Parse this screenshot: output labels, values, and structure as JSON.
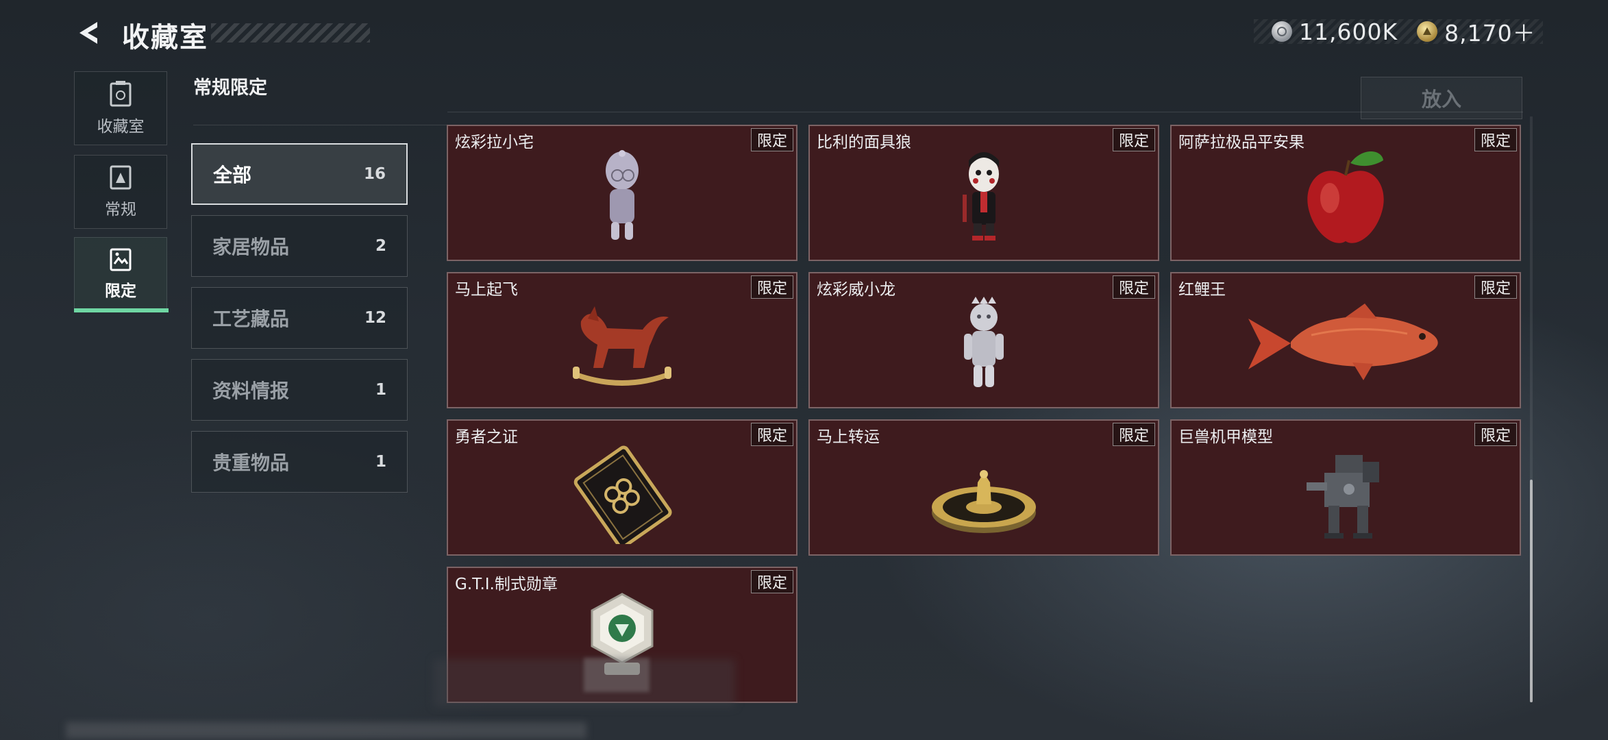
{
  "header": {
    "title": "收藏室",
    "currencies": [
      {
        "icon": "silver-coin-icon",
        "value": "11,600K"
      },
      {
        "icon": "gold-coin-icon",
        "value": "8,170＋"
      }
    ]
  },
  "sidebar": {
    "items": [
      {
        "label": "收藏室",
        "icon": "collection-room-icon",
        "active": false
      },
      {
        "label": "常规",
        "icon": "regular-icon",
        "active": false
      },
      {
        "label": "限定",
        "icon": "limited-icon",
        "active": true
      }
    ]
  },
  "section": {
    "title": "常规限定"
  },
  "categories": [
    {
      "label": "全部",
      "count": "16",
      "active": true
    },
    {
      "label": "家居物品",
      "count": "2",
      "active": false
    },
    {
      "label": "工艺藏品",
      "count": "12",
      "active": false
    },
    {
      "label": "资料情报",
      "count": "1",
      "active": false
    },
    {
      "label": "贵重物品",
      "count": "1",
      "active": false
    }
  ],
  "put_button": {
    "label": "放入"
  },
  "items": [
    {
      "name": "炫彩拉小宅",
      "tag": "限定",
      "art": "doll-figure-icon"
    },
    {
      "name": "比利的面具狼",
      "tag": "限定",
      "art": "puppet-mask-icon"
    },
    {
      "name": "阿萨拉极品平安果",
      "tag": "限定",
      "art": "apple-icon"
    },
    {
      "name": "马上起飞",
      "tag": "限定",
      "art": "rocking-horse-icon"
    },
    {
      "name": "炫彩威小龙",
      "tag": "限定",
      "art": "dragon-figure-icon"
    },
    {
      "name": "红鲤王",
      "tag": "限定",
      "art": "carp-fish-icon"
    },
    {
      "name": "勇者之证",
      "tag": "限定",
      "art": "card-plaque-icon"
    },
    {
      "name": "马上转运",
      "tag": "限定",
      "art": "fortune-disc-icon"
    },
    {
      "name": "巨兽机甲模型",
      "tag": "限定",
      "art": "mech-model-icon"
    },
    {
      "name": "G.T.I.制式勋章",
      "tag": "限定",
      "art": "medal-badge-icon"
    }
  ],
  "colors": {
    "accent": "#6fd6a3",
    "card_bg": "#3e1b1e"
  }
}
